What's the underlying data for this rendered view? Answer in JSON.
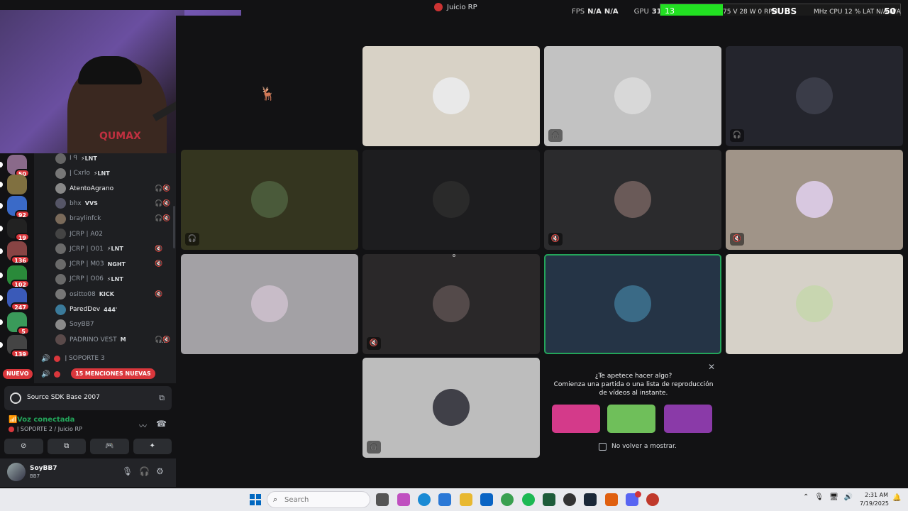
{
  "window": {
    "title": "Juicio RP"
  },
  "overlay": {
    "fps_label": "FPS",
    "fps_value_1": "N/A",
    "fps_value_2": "N/A",
    "gpu_label": "GPU",
    "gpu_value": "31 %"
  },
  "subs": {
    "count": "13",
    "label": "SUBS",
    "goal": "50",
    "progress": 0.26,
    "metrics_left": "75 V  28 W  0 RPM",
    "metrics_right": "MHz   CPU 12 %      LAT N/A  N/A"
  },
  "webcam": {
    "shirt_text": "QUMAX"
  },
  "servers": [
    {
      "badge": "50"
    },
    {
      "badge": ""
    },
    {
      "badge": "92"
    },
    {
      "badge": "19"
    },
    {
      "badge": "136"
    },
    {
      "badge": "102"
    },
    {
      "badge": "247"
    },
    {
      "badge": "5"
    },
    {
      "badge": "139"
    }
  ],
  "new_badge": "NUEVO",
  "voice_users": [
    {
      "name": "I ꟼ",
      "tag": "⚡LNT",
      "speaking": false,
      "icons": ""
    },
    {
      "name": "ǀ Cxrlo",
      "tag": "⚡LNT",
      "speaking": false,
      "icons": ""
    },
    {
      "name": "AtentoAgrano",
      "tag": "",
      "speaking": true,
      "icons": "🎧🔇"
    },
    {
      "name": "bhx",
      "tag": "VVS",
      "speaking": false,
      "icons": "🎧🔇"
    },
    {
      "name": "braylinfck",
      "tag": "",
      "speaking": false,
      "icons": "🎧🔇"
    },
    {
      "name": "JCRP | A02",
      "tag": "",
      "speaking": false,
      "icons": ""
    },
    {
      "name": "JCRP | O01",
      "tag": "⚡LNT",
      "speaking": false,
      "icons": "🔇"
    },
    {
      "name": "JCRP | M03",
      "tag": "NGHT",
      "speaking": false,
      "icons": "🔇"
    },
    {
      "name": "JCRP | O06",
      "tag": "⚡LNT",
      "speaking": false,
      "icons": ""
    },
    {
      "name": "ositto08",
      "tag": "KICK",
      "speaking": false,
      "icons": "🔇"
    },
    {
      "name": "ParedDev",
      "tag": "444'",
      "speaking": true,
      "icons": ""
    },
    {
      "name": "SoyBB7",
      "tag": "",
      "speaking": false,
      "icons": ""
    },
    {
      "name": "PADRINO VEST",
      "tag": "M",
      "speaking": false,
      "icons": "🎧🔇"
    }
  ],
  "user_more": "···",
  "channels": [
    {
      "name": "ǀ SOPORTE 3"
    },
    {
      "name": ""
    }
  ],
  "mentions_badge": "15 MENCIONES NUEVAS",
  "activity": {
    "name": "Source SDK Base 2007"
  },
  "voice": {
    "state": "Voz conectada",
    "location": "ǀ SOPORTE 2 / Juicio RP"
  },
  "user": {
    "name": "SoyBB7",
    "status": "BB7"
  },
  "tiles": [
    {
      "bg": "#d8d2c6",
      "av": "#e9e9e9",
      "corner": ""
    },
    {
      "bg": "#c2c2c2",
      "av": "#d8d8d8",
      "corner": "🎧"
    },
    {
      "bg": "#24252d",
      "av": "#3a3c48",
      "corner": "🎧"
    },
    {
      "bg": "#34351f",
      "av": "#4a5a3a",
      "corner": "🎧"
    },
    {
      "bg": "#1d1d1f",
      "av": "#2a2a2a",
      "corner": ""
    },
    {
      "bg": "#2b2b2d",
      "av": "#6a5a58",
      "corner": "🔇"
    },
    {
      "bg": "#a09488",
      "av": "#d8c8e0",
      "corner": "🔇"
    },
    {
      "bg": "#a3a1a5",
      "av": "#c8bcc8",
      "corner": ""
    },
    {
      "bg": "#2a2829",
      "av": "#544a4a",
      "corner": "🔇"
    },
    {
      "bg": "#253446",
      "av": "#3a6a86",
      "corner": ""
    },
    {
      "bg": "#d6d1c8",
      "av": "#c8d6b0",
      "corner": ""
    },
    {
      "bg": "#bdbdbd",
      "av": "#404048",
      "corner": "🎧"
    }
  ],
  "prompt": {
    "heading_1": "¿Te apetece hacer algo?",
    "heading_2": "Comienza una partida o una lista de reproducción",
    "heading_3": "de vídeos al instante.",
    "checkbox_label": "No volver a mostrar.",
    "games": [
      {
        "color": "#d43a8a"
      },
      {
        "color": "#6fbf5a"
      },
      {
        "color": "#8a3aa8"
      }
    ]
  },
  "taskbar": {
    "search_placeholder": "Search",
    "time": "2:31 AM",
    "date": "7/19/2025"
  }
}
